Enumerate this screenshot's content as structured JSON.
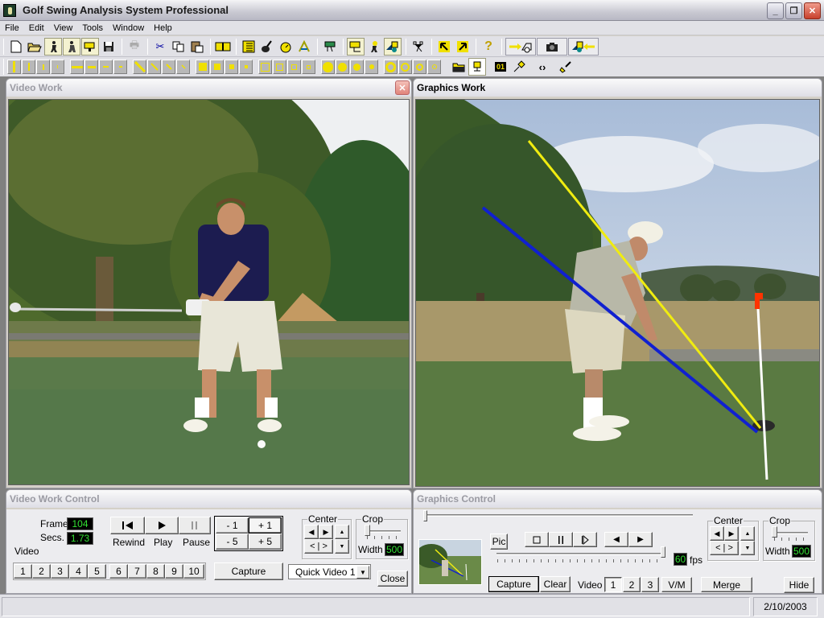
{
  "window": {
    "title": "Golf Swing Analysis System Professional",
    "minimize_label": "_",
    "restore_label": "❐",
    "close_label": "✕"
  },
  "menu": [
    "File",
    "Edit",
    "View",
    "Tools",
    "Window",
    "Help"
  ],
  "toolbar1": {
    "icons": [
      {
        "name": "new-file-icon",
        "glyph": "🗋"
      },
      {
        "name": "open-folder-icon",
        "glyph": "📂"
      },
      {
        "name": "golfer-front-icon",
        "glyph": "🏌"
      },
      {
        "name": "golfer-side-icon",
        "glyph": "🏌"
      },
      {
        "name": "video-camera-icon",
        "glyph": "📹"
      },
      {
        "name": "save-icon",
        "glyph": "💾"
      },
      {
        "name": "print-icon",
        "glyph": "🖶"
      },
      {
        "name": "cut-icon",
        "glyph": "✂"
      },
      {
        "name": "copy-icon",
        "glyph": "⎘"
      },
      {
        "name": "paste-icon",
        "glyph": "📋"
      },
      {
        "name": "film-strip-icon",
        "glyph": "▮▮"
      },
      {
        "name": "notes-icon",
        "glyph": "📝"
      },
      {
        "name": "club-head-icon",
        "glyph": "⛳"
      },
      {
        "name": "stopwatch-icon",
        "glyph": "⏱"
      },
      {
        "name": "angle-tool-icon",
        "glyph": "📐"
      },
      {
        "name": "projector-icon",
        "glyph": "📽"
      },
      {
        "name": "camera-capture-icon",
        "glyph": "🎥"
      },
      {
        "name": "golfer-swing-icon",
        "glyph": "🏌"
      },
      {
        "name": "shapes-icon",
        "glyph": "◆"
      },
      {
        "name": "skeleton-tool-icon",
        "glyph": "⚟"
      },
      {
        "name": "arrow-up-left-icon",
        "glyph": "↖"
      },
      {
        "name": "arrow-up-right-icon",
        "glyph": "↗"
      },
      {
        "name": "help-icon",
        "glyph": "?"
      },
      {
        "name": "send-to-graphics-icon",
        "glyph": "➔◻"
      },
      {
        "name": "snapshot-camera-icon",
        "glyph": "📷"
      },
      {
        "name": "import-graphics-icon",
        "glyph": "◆⬅"
      }
    ]
  },
  "toolbar2": {
    "groups": [
      {
        "name": "vertical-line-width",
        "count": 4
      },
      {
        "name": "horizontal-line-width",
        "count": 4
      },
      {
        "name": "diagonal-line-width",
        "count": 4
      },
      {
        "name": "filled-square-size",
        "count": 4
      },
      {
        "name": "hollow-square-size",
        "count": 4
      },
      {
        "name": "filled-circle-size",
        "count": 4
      },
      {
        "name": "hollow-circle-size",
        "count": 4
      }
    ],
    "extra_icons": [
      {
        "name": "folder-icon",
        "glyph": "📁"
      },
      {
        "name": "stamp-icon",
        "glyph": "⊥"
      },
      {
        "name": "counter-icon",
        "glyph": "01"
      },
      {
        "name": "pin-icon",
        "glyph": "📌"
      },
      {
        "name": "code-brackets-icon",
        "glyph": "‹›"
      },
      {
        "name": "paint-brush-icon",
        "glyph": "🖌"
      }
    ]
  },
  "video_work": {
    "title": "Video Work"
  },
  "graphics_work": {
    "title": "Graphics Work",
    "overlay_colors": {
      "yellow_line": "#f0ec10",
      "blue_line": "#1020d0",
      "white_line": "#ffffff",
      "flag": "#ff3300"
    }
  },
  "video_control": {
    "title": "Video Work Control",
    "frame_label": "Frame",
    "frame_value": "104",
    "secs_label": "Secs.",
    "secs_value": "1.73",
    "video_label": "Video",
    "rewind_label": "Rewind",
    "play_label": "Play",
    "pause_label": "Pause",
    "step_buttons": [
      "- 1",
      "+ 1",
      "- 5",
      "+ 5"
    ],
    "video_slots": [
      "1",
      "2",
      "3",
      "4",
      "5",
      "6",
      "7",
      "8",
      "9",
      "10"
    ],
    "center_label": "Center",
    "center_mid": "< | >",
    "crop_label": "Crop",
    "width_label": "Width",
    "width_value": "500",
    "capture_label": "Capture",
    "quick_video_selected": "Quick Video 1",
    "close_label": "Close"
  },
  "graphics_control": {
    "title": "Graphics Control",
    "pic_label": "Pic",
    "fps_value": "60",
    "fps_label": "fps",
    "capture_label": "Capture",
    "clear_label": "Clear",
    "video_label": "Video",
    "video_slots": [
      "1",
      "2",
      "3"
    ],
    "vm_label": "V/M",
    "merge_label": "Merge",
    "center_label": "Center",
    "center_mid": "< | >",
    "crop_label": "Crop",
    "width_label": "Width",
    "width_value": "500",
    "hide_label": "Hide"
  },
  "status": {
    "date": "2/10/2003"
  }
}
